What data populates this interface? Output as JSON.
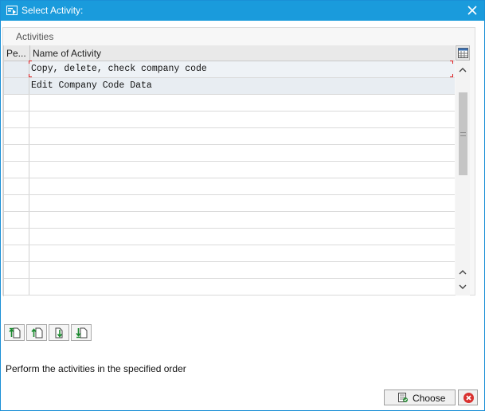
{
  "window": {
    "title": "Select Activity:"
  },
  "panel": {
    "label": "Activities"
  },
  "grid": {
    "columns": [
      "Pe...",
      "Name of Activity"
    ],
    "rows": [
      {
        "name": "Copy, delete, check company code"
      },
      {
        "name": "Edit Company Code Data"
      }
    ]
  },
  "footer": {
    "hint": "Perform the activities in the specified order",
    "choose_label": "Choose"
  },
  "colors": {
    "titlebar": "#1a9bdc",
    "selection_marker": "#e02020",
    "cancel_red": "#d9312f"
  }
}
